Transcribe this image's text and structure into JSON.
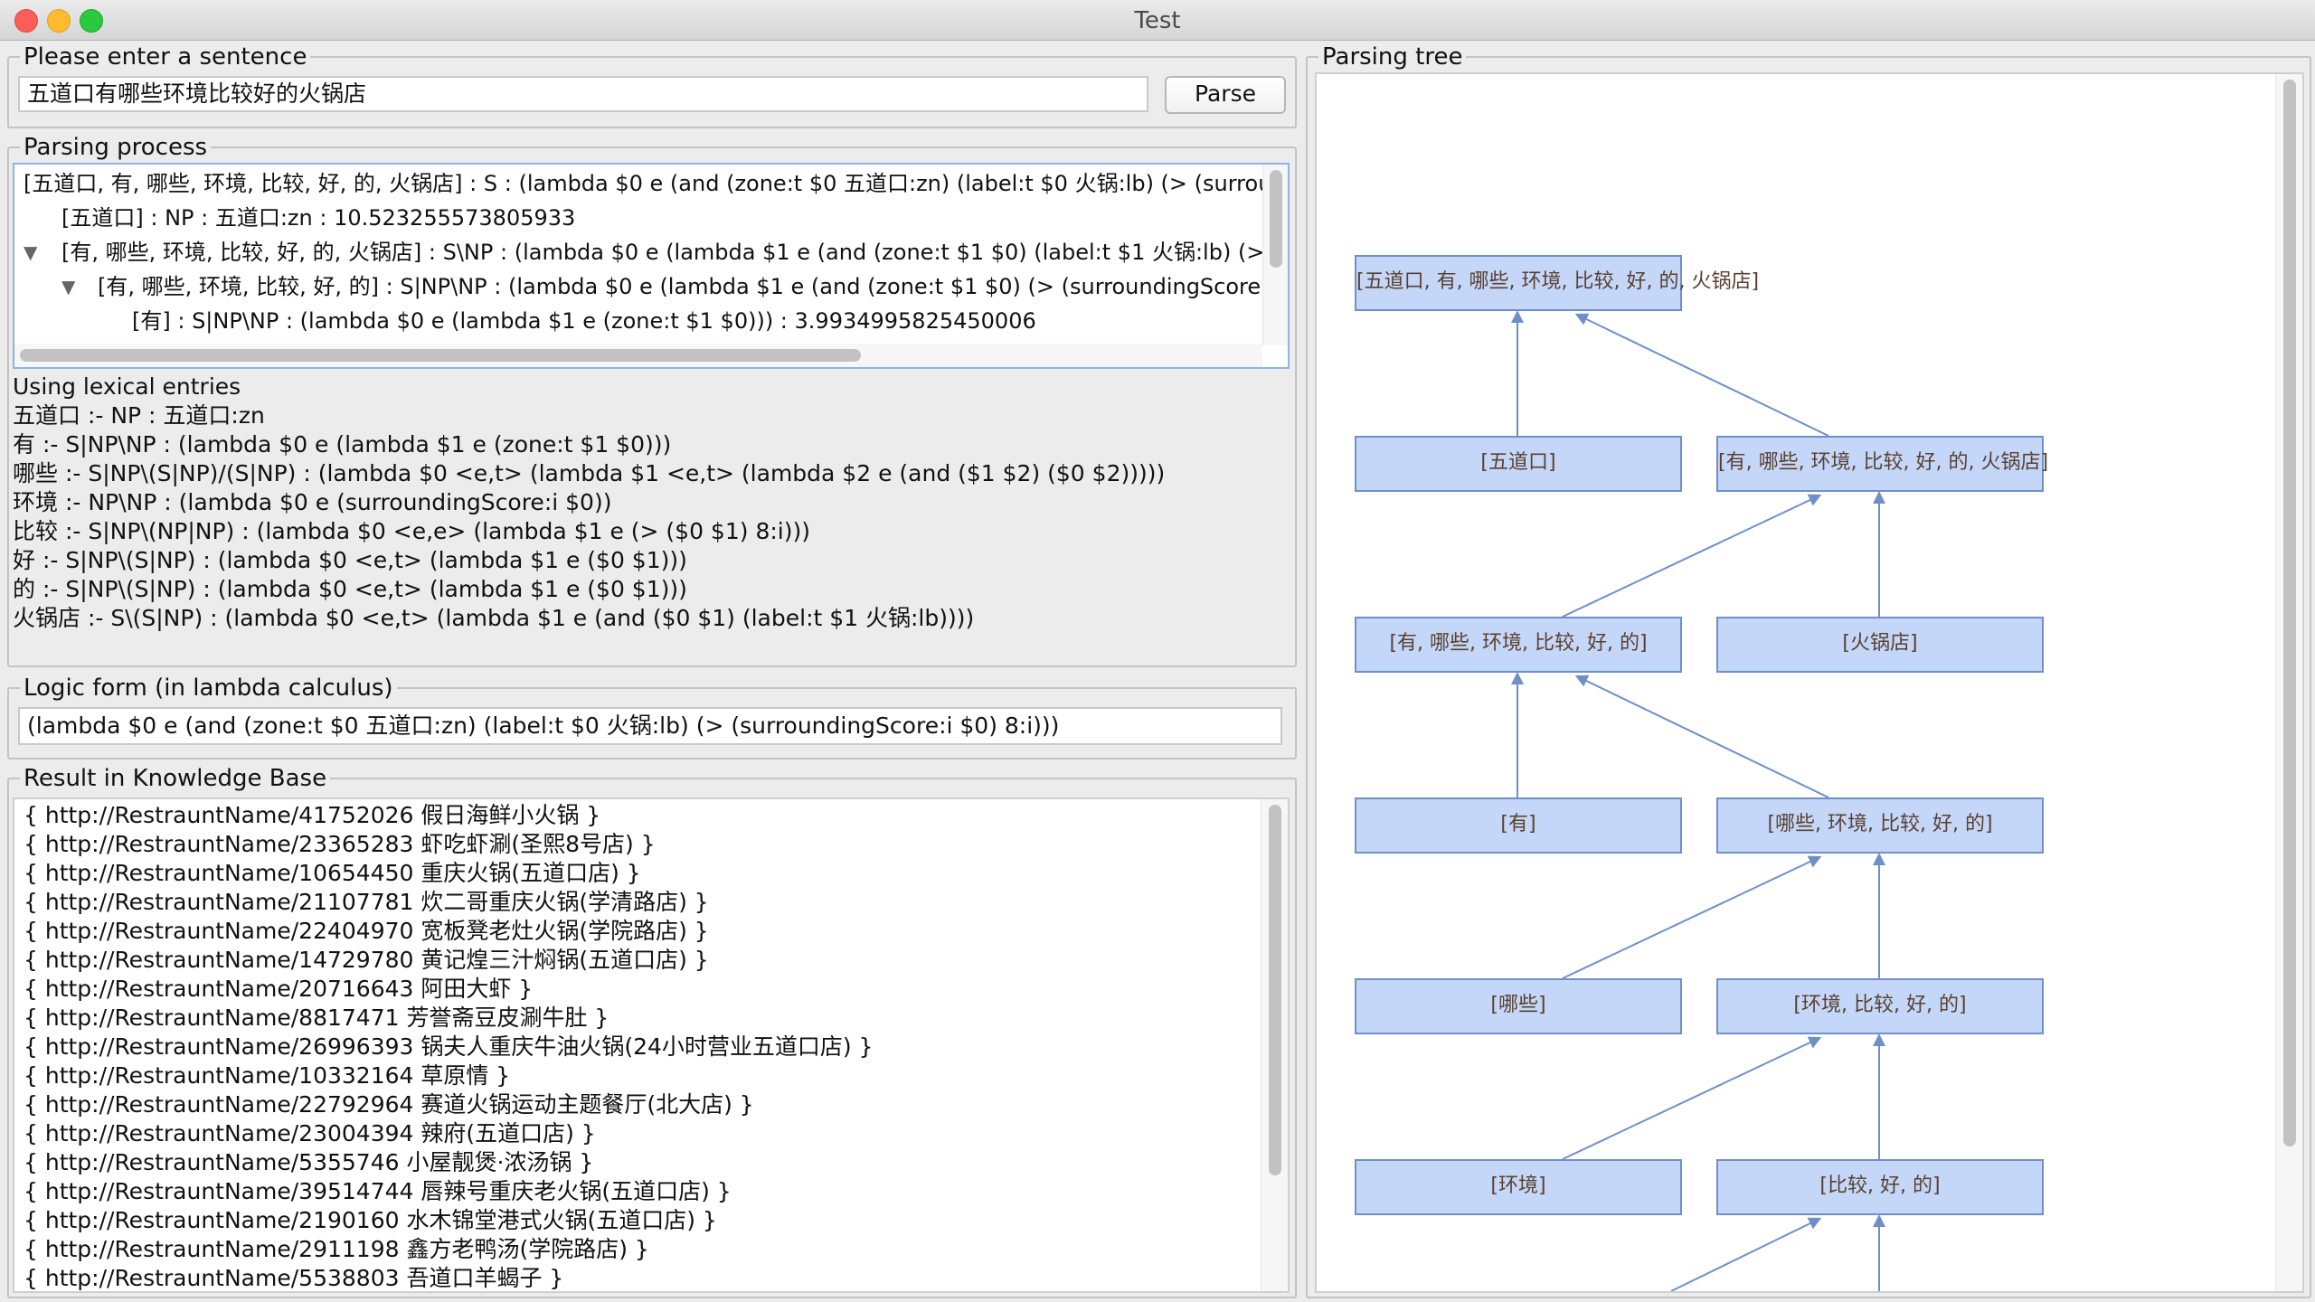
{
  "window": {
    "title": "Test"
  },
  "input_section": {
    "title": "Please enter a sentence",
    "sentence": "五道口有哪些环境比较好的火锅店",
    "parse_label": "Parse"
  },
  "parsing_process": {
    "title": "Parsing process",
    "rows": [
      "[五道口, 有, 哪些, 环境, 比较, 好, 的, 火锅店] : S : (lambda $0 e (and (zone:t $0 五道口:zn) (label:t $0 火锅:lb) (> (surrou",
      "[五道口] : NP : 五道口:zn : 10.523255573805933",
      "[有, 哪些, 环境, 比较, 好, 的, 火锅店] : S\\NP : (lambda $0 e (lambda $1 e (and (zone:t $1 $0) (label:t $1 火锅:lb) (> ",
      "[有, 哪些, 环境, 比较, 好, 的] : S|NP\\NP : (lambda $0 e (lambda $1 e (and (zone:t $1 $0) (> (surroundingScore:i",
      "[有] : S|NP\\NP : (lambda $0 e (lambda $1 e (zone:t $1 $0))) : 3.9934995825450006"
    ],
    "expand_glyph": "▼"
  },
  "lexical": {
    "title": "Using lexical entries",
    "entries": [
      "五道口  :- NP : 五道口:zn",
      "有  :- S|NP\\NP : (lambda $0 e (lambda $1 e (zone:t $1 $0)))",
      "哪些  :- S|NP\\(S|NP)/(S|NP) : (lambda $0 <e,t> (lambda $1 <e,t> (lambda $2 e (and ($1 $2) ($0 $2)))))",
      "环境  :- NP\\NP : (lambda $0 e (surroundingScore:i $0))",
      "比较  :- S|NP\\(NP|NP) : (lambda $0 <e,e> (lambda $1 e (> ($0 $1) 8:i)))",
      "好  :- S|NP\\(S|NP) : (lambda $0 <e,t> (lambda $1 e ($0 $1)))",
      "的  :- S|NP\\(S|NP) : (lambda $0 <e,t> (lambda $1 e ($0 $1)))",
      "火锅店  :- S\\(S|NP) : (lambda $0 <e,t> (lambda $1 e (and ($0 $1) (label:t $1 火锅:lb))))"
    ]
  },
  "logic_form": {
    "title": "Logic form (in lambda calculus)",
    "value": "(lambda $0 e (and (zone:t $0 五道口:zn) (label:t $0 火锅:lb) (> (surroundingScore:i $0) 8:i)))"
  },
  "results": {
    "title": "Result in Knowledge Base",
    "items": [
      "{ http://RestrauntName/41752026 假日海鲜小火锅 }",
      "{ http://RestrauntName/23365283 虾吃虾涮(圣熙8号店) }",
      "{ http://RestrauntName/10654450 重庆火锅(五道口店) }",
      "{ http://RestrauntName/21107781 炊二哥重庆火锅(学清路店) }",
      "{ http://RestrauntName/22404970 宽板凳老灶火锅(学院路店) }",
      "{ http://RestrauntName/14729780 黄记煌三汁焖锅(五道口店) }",
      "{ http://RestrauntName/20716643 阿田大虾 }",
      "{ http://RestrauntName/8817471 芳誉斋豆皮涮牛肚 }",
      "{ http://RestrauntName/26996393 锅夫人重庆牛油火锅(24小时营业五道口店) }",
      "{ http://RestrauntName/10332164 草原情 }",
      "{ http://RestrauntName/22792964 赛道火锅运动主题餐厅(北大店) }",
      "{ http://RestrauntName/23004394 辣府(五道口店) }",
      "{ http://RestrauntName/5355746 小屋靓煲·浓汤锅 }",
      "{ http://RestrauntName/39514744 唇辣号重庆老火锅(五道口店) }",
      "{ http://RestrauntName/2190160 水木锦堂港式火锅(五道口店) }",
      "{ http://RestrauntName/2911198 鑫方老鸭汤(学院路店) }",
      "{ http://RestrauntName/5538803 吾道口羊蝎子 }"
    ]
  },
  "parsing_tree": {
    "title": "Parsing tree",
    "nodes": [
      "[五道口, 有, 哪些, 环境, 比较, 好, 的, 火锅店]",
      "[五道口]",
      "[有, 哪些, 环境, 比较, 好, 的, 火锅店]",
      "[有, 哪些, 环境, 比较, 好, 的]",
      "[火锅店]",
      "[有]",
      "[哪些, 环境, 比较, 好, 的]",
      "[哪些]",
      "[环境, 比较, 好, 的]",
      "[环境]",
      "[比较, 好, 的]"
    ],
    "colors": {
      "node_fill": "#c4d7f8",
      "node_border": "#6e8fc8",
      "edge": "#6e8fc8",
      "node_text": "#5a4030"
    }
  }
}
